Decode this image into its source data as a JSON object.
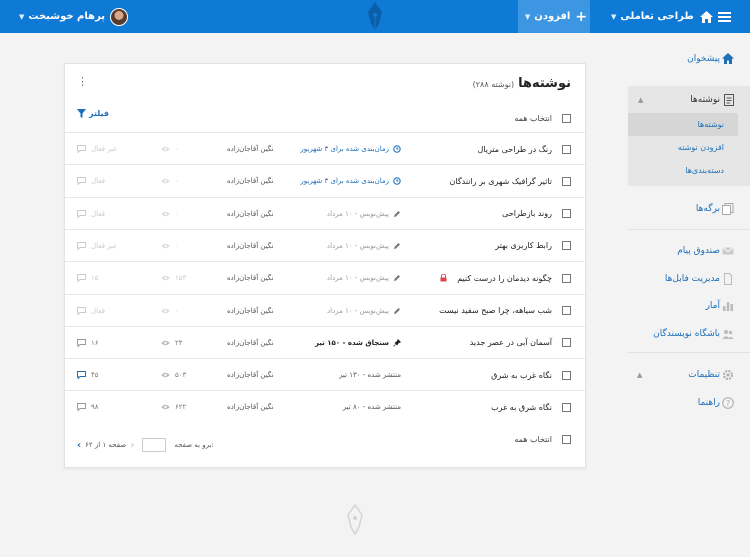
{
  "topbar": {
    "user_name": "پرهام خوشبخت",
    "add_label": "افزودن",
    "site_name": "طراحی تعاملی"
  },
  "sidebar": {
    "dashboard": "پیشخوان",
    "posts": "نوشته‌ها",
    "posts_sub": [
      "نوشته‌ها",
      "افزودن نوشته",
      "دسته‌بندی‌ها"
    ],
    "pages": "برگه‌ها",
    "inbox": "صندوق پیام",
    "files": "مدیریت فایل‌ها",
    "stats": "آمار",
    "writers_club": "باشگاه نویسندگان",
    "settings": "تنظیمات",
    "help": "راهنما"
  },
  "posts_card": {
    "title": "نوشته‌ها",
    "count_text": "(۲۸۸ نوشته)",
    "filter_label": "فیلتر",
    "select_all": "انتخاب همه",
    "rows": [
      {
        "title": "رنگ در طراحی متریال",
        "status": "زمان‌بندی شده برای ۳ شهریور",
        "status_icon": "clock-icon",
        "status_style": "blue",
        "author": "نگین آقاجان‌زاده",
        "views": "۰",
        "comments": "غیر فعال",
        "dimmed": true
      },
      {
        "title": "تاثیر گرافیک شهری بر رانندگان",
        "status": "زمان‌بندی شده برای ۳ شهریور",
        "status_icon": "clock-icon",
        "status_style": "blue",
        "author": "نگین آقاجان‌زاده",
        "views": "۰",
        "comments": "فعال",
        "dimmed": true
      },
      {
        "title": "روند بازطراحی",
        "status": "پیش‌نویس - ۱۰ مرداد",
        "status_icon": "pencil-icon",
        "status_style": "gray",
        "author": "نگین آقاجان‌زاده",
        "views": "۰",
        "comments": "فعال",
        "dimmed": true
      },
      {
        "title": "رابط کاربری بهتر",
        "status": "پیش‌نویس - ۱۰ مرداد",
        "status_icon": "pencil-icon",
        "status_style": "gray",
        "author": "نگین آقاجان‌زاده",
        "views": "۰",
        "comments": "غیر فعال",
        "dimmed": true
      },
      {
        "title": "چگونه دیدمان را درست کنیم",
        "status": "پیش‌نویس - ۱۰ مرداد",
        "status_icon": "pencil-icon",
        "status_style": "gray",
        "author": "نگین آقاجان‌زاده",
        "views": "۱۵۳",
        "comments": "۱۵",
        "dimmed": true,
        "locked": true
      },
      {
        "title": "شب سیاهه، چرا صبح سفید نیست",
        "status": "پیش‌نویس - ۱۰ مرداد",
        "status_icon": "pencil-icon",
        "status_style": "gray",
        "author": "نگین آقاجان‌زاده",
        "views": "۰",
        "comments": "فعال",
        "dimmed": true
      },
      {
        "title": "آسمان آبی در عصر جدید",
        "status": "سنجاق شده - ۱۵۰ تیر",
        "status_icon": "pin-icon",
        "status_style": "dark",
        "author": "نگین آقاجان‌زاده",
        "views": "۲۴",
        "comments": "۱۶",
        "dimmed": false
      },
      {
        "title": "نگاه غرب به شرق",
        "status": "منتشر شده - ۱۳۰ تیر",
        "status_icon": "",
        "status_style": "pub",
        "author": "نگین آقاجان‌زاده",
        "views": "۵۰۳",
        "comments": "۴۵",
        "dimmed": false,
        "comment_highlight": true
      },
      {
        "title": "نگاه شرق به غرب",
        "status": "منتشر شده - ۸۰ تیر",
        "status_icon": "",
        "status_style": "pub",
        "author": "نگین آقاجان‌زاده",
        "views": "۶۲۲",
        "comments": "۹۸",
        "dimmed": false
      }
    ],
    "pager": {
      "goto_label": "برو به صفحه:",
      "page_text": "صفحه ۱ از ۶۲"
    }
  },
  "colors": {
    "topbar": "#0f7ad6",
    "topbar_active": "#3d96e2",
    "link": "#1c6fb8"
  }
}
